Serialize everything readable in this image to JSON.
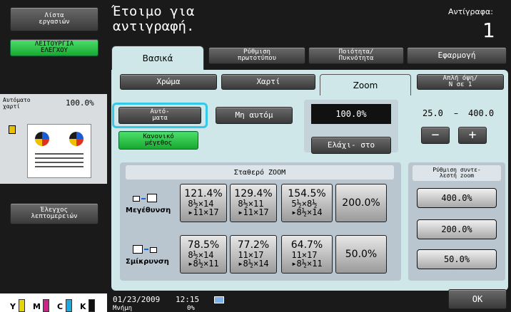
{
  "sidebar": {
    "work_settings": "Λίστα\nεργασιών",
    "control_function": "ΛΕΙΤΟΥΡΓΙΑ\nΕΛΕΓΧΟΥ",
    "auto_paper": "Αυτόματο\nχαρτί",
    "zoom_value": "100.0%",
    "detail_check": "Έλεγχος\nλεπτομερειών",
    "toner": [
      "Y",
      "M",
      "C",
      "K"
    ]
  },
  "header": {
    "status": "Έτοιμο για\nαντιγραφή.",
    "copies_label": "Αντίγραφα:",
    "copies_value": "1"
  },
  "tabs": {
    "basic": "Βασικά",
    "original": "Ρύθμιση\nπρωτοτύπου",
    "quality": "Ποιότητα/\nΠυκνότητα",
    "application": "Εφαρμογή"
  },
  "subtabs": {
    "color": "Χρώμα",
    "paper": "Χαρτί",
    "zoom": "Zoom",
    "simplex": "Απλή όψη/\nΝ σε 1"
  },
  "zoom": {
    "auto": "Αυτό-\nματα",
    "not_auto": "Μη αυτόμ",
    "normal_size": "Κανονικό\nμέγεθος",
    "current": "100.0%",
    "minimal": "Ελάχι- στο",
    "range_min": "25.0",
    "range_dash": "–",
    "range_max": "400.0",
    "minus": "−",
    "plus": "+"
  },
  "fixed": {
    "title": "Σταθερό ZOOM",
    "enlarge": "Μεγέθυνση",
    "reduce": "Σμίκρυνση",
    "enlarge_items": [
      {
        "pct": "121.4%",
        "size": "8½×14\n▸11×17"
      },
      {
        "pct": "129.4%",
        "size": "8½×11\n▸11×17"
      },
      {
        "pct": "154.5%",
        "size": "5½×8½\n▸8½×14"
      },
      {
        "pct": "200.0%",
        "size": ""
      }
    ],
    "reduce_items": [
      {
        "pct": "78.5%",
        "size": "8½×14\n▸8½×11"
      },
      {
        "pct": "77.2%",
        "size": "11×17\n▸8½×14"
      },
      {
        "pct": "64.7%",
        "size": "11×17\n▸8½×11"
      },
      {
        "pct": "50.0%",
        "size": ""
      }
    ]
  },
  "preset": {
    "title": "Ρύθμιση συντε-\nλεστή zoom",
    "values": [
      "400.0%",
      "200.0%",
      "50.0%"
    ]
  },
  "footer": {
    "date": "01/23/2009",
    "time": "12:15",
    "memory": "Μνήμη",
    "memory_pct": "0%",
    "ok": "OK"
  }
}
